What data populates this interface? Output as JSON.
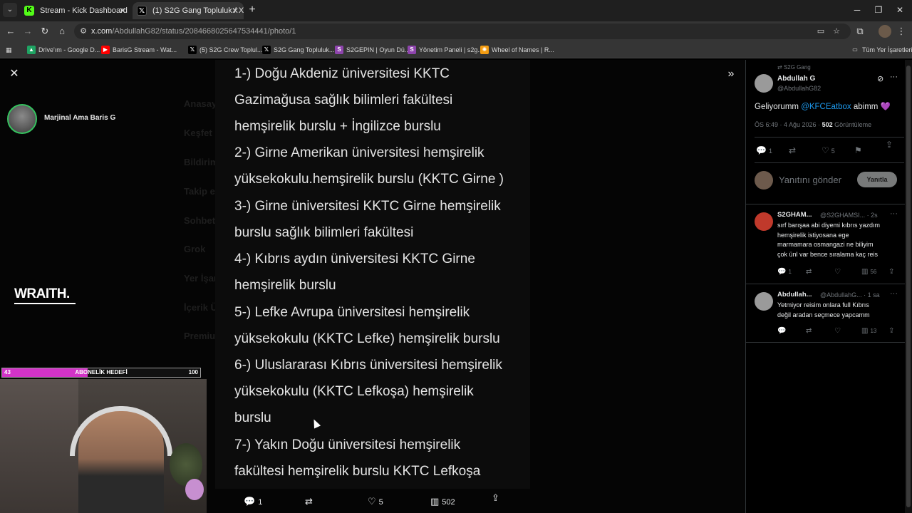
{
  "browser": {
    "tabs": [
      {
        "title": "Stream - Kick Dashboard",
        "favicon": "kick-icon",
        "active": false
      },
      {
        "title": "(1) S2G Gang Topluluk / X",
        "favicon": "x-icon",
        "active": true
      }
    ],
    "url_host": "x.com",
    "url_path": "/AbdullahG82/status/2084668025647534441/photo/1",
    "bookmarks": [
      {
        "label": "Drive'ım - Google D...",
        "icon": "google-drive-icon",
        "color": "#1fa463"
      },
      {
        "label": "BarisG Stream - Wat...",
        "icon": "youtube-icon",
        "color": "#ff0000"
      },
      {
        "label": "(5) S2G Crew Toplul...",
        "icon": "x-icon",
        "color": "#000000"
      },
      {
        "label": "S2G Gang Topluluk...",
        "icon": "x-icon",
        "color": "#000000"
      },
      {
        "label": "S2GEPIN | Oyun Dü...",
        "icon": "s2gepin-icon",
        "color": "#8e44ad"
      },
      {
        "label": "Yönetim Paneli | s2g...",
        "icon": "panel-icon",
        "color": "#8e44ad"
      },
      {
        "label": "Wheel of Names | R...",
        "icon": "wheel-icon",
        "color": "#f39c12"
      }
    ],
    "bookmarks_all": "Tüm Yer İşaretleri"
  },
  "stream": {
    "streamer_name": "Marjinal Ama Baris G",
    "sponsor": "WRAITH.",
    "sub_goal": {
      "label": "ABONELİK HEDEFİ",
      "current": "43",
      "target": "100",
      "progress": 0.43
    }
  },
  "photo": {
    "lines": [
      "1-) Doğu Akdeniz üniversitesi KKTC",
      "Gazimağusa sağlık bilimleri fakültesi",
      "hemşirelik burslu + İngilizce burslu",
      "2-) Girne Amerikan üniversitesi hemşirelik",
      "yüksekokulu.hemşirelik burslu (KKTC Girne )",
      "3-) Girne üniversitesi KKTC Girne hemşirelik",
      "burslu sağlık bilimleri fakültesi",
      "4-) Kıbrıs aydın üniversitesi KKTC Girne",
      "hemşirelik burslu",
      "5-) Lefke Avrupa üniversitesi hemşirelik",
      "yüksekokulu (KKTC Lefke) hemşirelik burslu",
      "6-) Uluslararası Kıbrıs üniversitesi hemşirelik",
      "yüksekokulu (KKTC Lefkoşa) hemşirelik",
      "burslu",
      "7-) Yakın Doğu üniversitesi hemşirelik",
      "fakültesi hemşirelik burslu KKTC Lefkoşa"
    ],
    "actions": {
      "replies": "1",
      "likes": "5",
      "views": "502"
    }
  },
  "background_menu": [
    "Anasayfa",
    "Keşfet",
    "Bildirimler",
    "Takip et",
    "Sohbet",
    "Grok",
    "Yer İşaretleri",
    "İçerik Üreticisi",
    "Premium"
  ],
  "tweet": {
    "context": "S2G Gang",
    "author_name": "Abdullah G",
    "author_handle": "@AbdullahG82",
    "text_before": "Geliyorumm ",
    "mention": "@KFCEatbox",
    "text_after": " abimm ",
    "heart": "💜",
    "time": "ÖS 6:49 · 4 Ağu 2026 · ",
    "views": "502",
    "views_label": " Görüntüleme",
    "replies": "1",
    "likes": "5",
    "reply_placeholder": "Yanıtını gönder",
    "reply_button": "Yanıtla"
  },
  "replies": [
    {
      "name": "S2GHAM...",
      "meta": "@S2GHAMSI... · 2s",
      "text": "sırf barışaa abi diyemi kıbrıs yazdım\nhemşirelik istiyosana ege\nmarmamara osmangazi  ne biliyim\nçok ünl var bence sıralama kaç reis",
      "replies": "1",
      "views": "56",
      "avatar_color": "#c0392b"
    },
    {
      "name": "Abdullah...",
      "meta": "@AbdullahG... · 1 sa",
      "text": "Yetmiyor reisim onlara  full Kıbrıs\ndeğil aradan seçmece yapcamm",
      "replies": "",
      "views": "13",
      "avatar_color": "#9a9a9a"
    }
  ]
}
